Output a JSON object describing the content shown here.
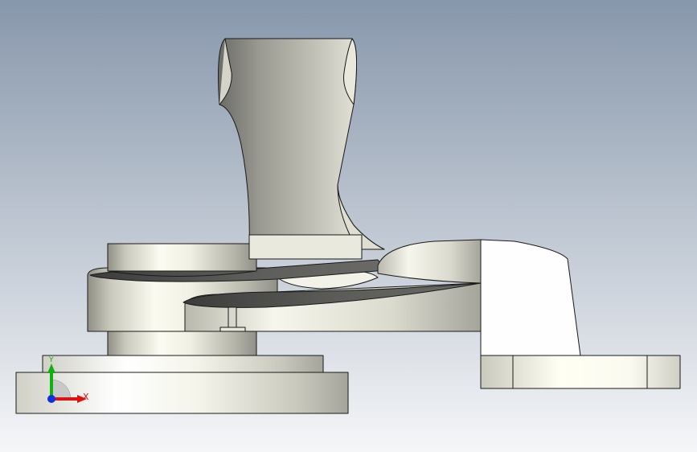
{
  "viewport": {
    "background_top": "#8797ab",
    "background_bottom": "#f5f6f8",
    "edge_color": "#1a1a1a"
  },
  "triad": {
    "x_label": "X",
    "y_label": "Y",
    "x_color": "#e01010",
    "y_color": "#10b010",
    "z_color": "#1030e0"
  }
}
